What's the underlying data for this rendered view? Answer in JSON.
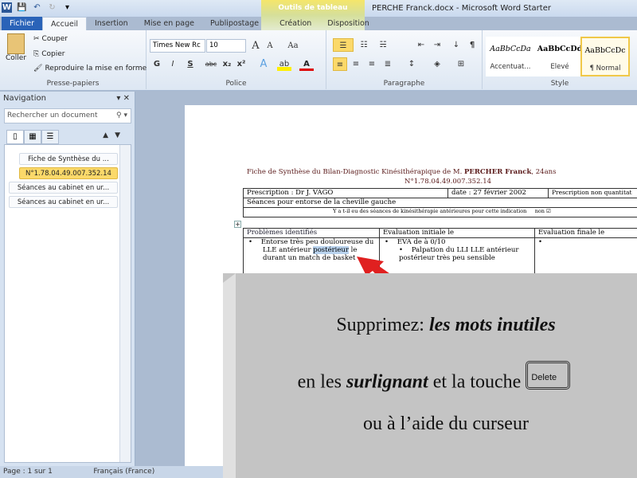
{
  "window": {
    "title": "PERCHE Franck.docx - Microsoft Word Starter",
    "context_tab": "Outils de tableau",
    "app_icon": "W"
  },
  "tabs": [
    "Fichier",
    "Accueil",
    "Insertion",
    "Mise en page",
    "Publipostage",
    "Création",
    "Disposition"
  ],
  "ribbon": {
    "clipboard": {
      "label": "Presse-papiers",
      "paste": "Coller",
      "cut": "Couper",
      "copy": "Copier",
      "format_painter": "Reproduire la mise en forme"
    },
    "font": {
      "label": "Police",
      "font_name": "Times New Rc",
      "font_size": "10",
      "bold": "G",
      "italic": "I",
      "underline": "S",
      "strike": "abc",
      "sub": "x₂",
      "sup": "x²",
      "case": "Aa",
      "grow": "A",
      "shrink": "A",
      "color": "A"
    },
    "paragraph": {
      "label": "Paragraphe",
      "pilcrow": "¶"
    },
    "styles": {
      "label": "Style",
      "items": [
        {
          "sample": "AaBbCcDa",
          "name": "Accentuat..."
        },
        {
          "sample": "AaBbCcDd",
          "name": "Elevé"
        },
        {
          "sample": "AaBbCcDc",
          "name": "¶ Normal"
        }
      ]
    }
  },
  "navigation": {
    "title": "Navigation",
    "search_placeholder": "Rechercher un document",
    "items": [
      "Fiche de Synthèse du ...",
      "N°1.78.04.49.007.352.14",
      "Séances au cabinet en ur...",
      "Séances au cabinet en ur..."
    ],
    "selected_index": 1
  },
  "document": {
    "heading_pre": "Fiche de Synthèse du Bilan-Diagnostic  Kinésithérapique de M. ",
    "heading_name": "PERCHER  Franck",
    ",": "",
    "heading_post": ", 24ans",
    "number": "N°1.78.04.49.007.352.14",
    "prescription": "Prescription : Dr  J. VAGO",
    "date": "date :   27 février 2002",
    "prescription_type": "Prescription  non  quantitat",
    "seances": "Séances pour entorse de la cheville gauche",
    "question": "Y a t-il eu des séances de kinésithérapie antérieures pour cette indication",
    "answer": "non  ☑",
    "col1": "Problèmes identifiés",
    "col2": "Evaluation initiale  le",
    "col3": "Evaluation finale  le",
    "c1_a": "Entorse très peu douloureuse du LLE  antérieur ",
    "c1_sel": "postérieur",
    "c1_b": " le",
    "c1_c": "durant un match  de basket",
    "c2_a": "EVA  de à 0/10",
    "c2_b": "Palpation du LLI  LLE  antérieur postérieur très peu sensible"
  },
  "overlay": {
    "line1_pre": "Supprimez: ",
    "line1_em": "les mots inutiles",
    "line2_pre": "en les ",
    "line2_em": "surlignant",
    "line2_post": " et la touche",
    "key": "Delete",
    "line3": "ou à l’aide du curseur"
  },
  "status": {
    "text": "Page : 1 sur 1",
    "language": "Français (France)"
  },
  "colors": {
    "file_tab": "#2a63b8",
    "selected": "#fbd96a",
    "overlay": "#c4c4c4",
    "arrow": "#e02020"
  }
}
